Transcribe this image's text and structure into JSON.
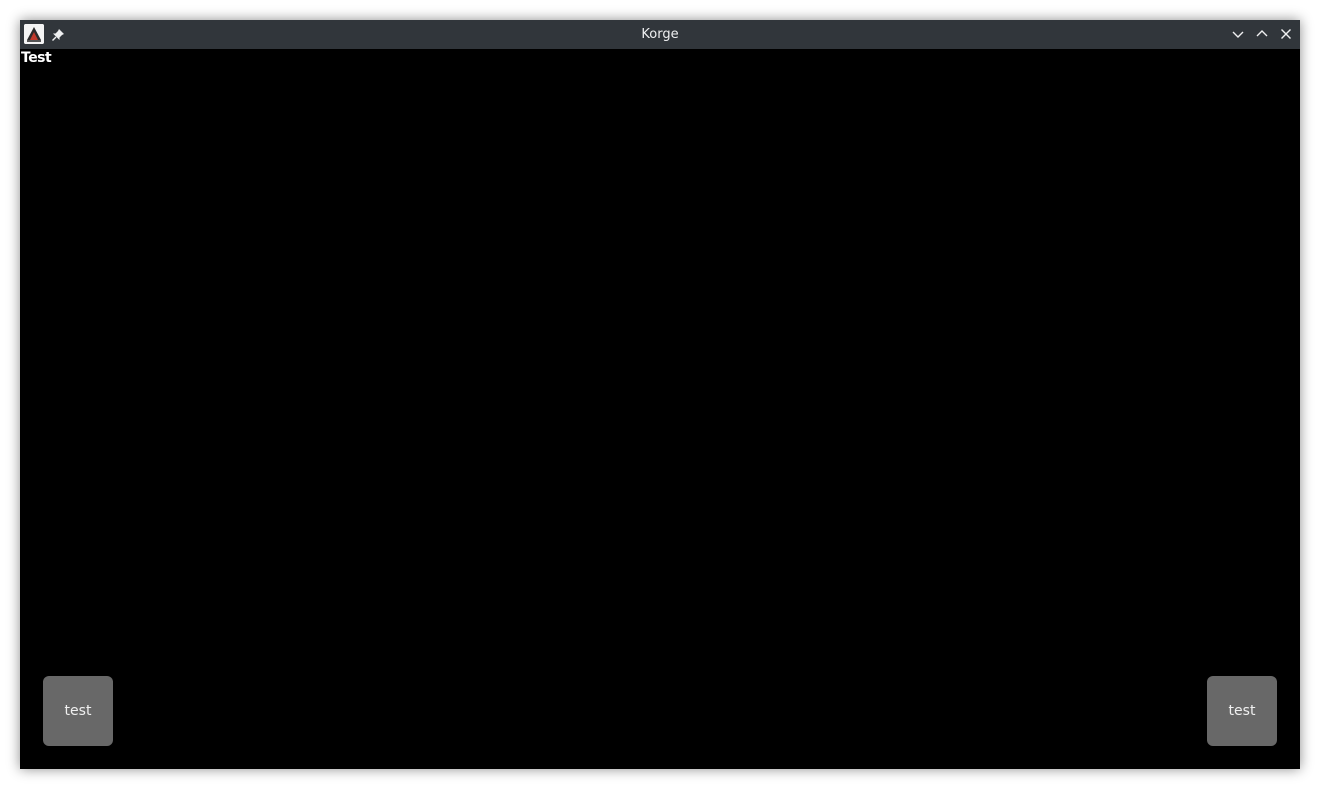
{
  "window": {
    "title": "Korge"
  },
  "game": {
    "debug_text": "Test",
    "buttons": [
      {
        "label": "test"
      },
      {
        "label": "test"
      }
    ]
  },
  "icons": {
    "app": "korge-app-icon",
    "pin": "pin-icon",
    "minimize": "chevron-down-icon",
    "maximize": "chevron-up-icon",
    "close": "close-icon"
  },
  "colors": {
    "titlebar": "#31363b",
    "title_text": "#eff0f1",
    "canvas": "#000000",
    "button_bg": "#686868",
    "button_text": "#f0f0f0"
  }
}
